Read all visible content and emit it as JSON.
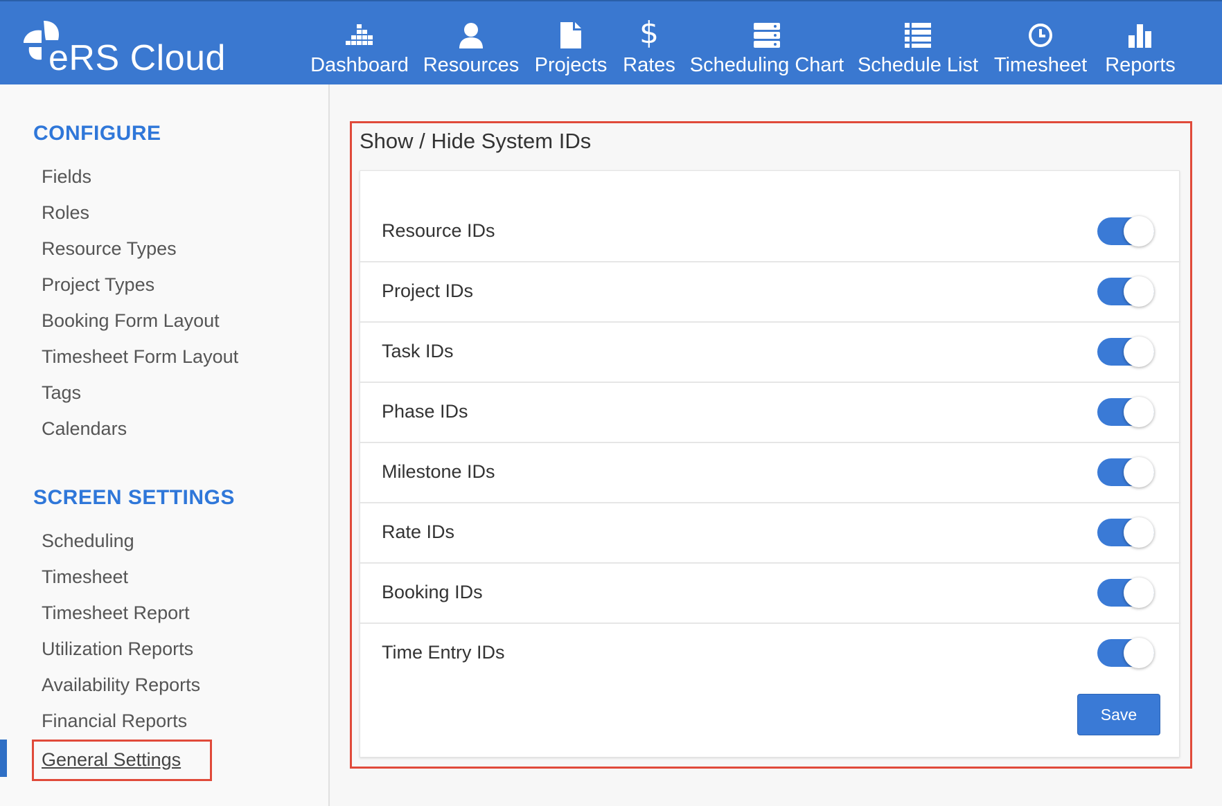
{
  "app": {
    "name": "eRS Cloud"
  },
  "nav": [
    {
      "label": "Dashboard",
      "icon": "dashboard-grid-icon"
    },
    {
      "label": "Resources",
      "icon": "user-icon"
    },
    {
      "label": "Projects",
      "icon": "document-icon"
    },
    {
      "label": "Rates",
      "icon": "dollar-icon"
    },
    {
      "label": "Scheduling Chart",
      "icon": "server-stack-icon"
    },
    {
      "label": "Schedule List",
      "icon": "list-icon"
    },
    {
      "label": "Timesheet",
      "icon": "clock-icon"
    },
    {
      "label": "Reports",
      "icon": "bar-chart-icon"
    }
  ],
  "sidebar": {
    "configure_title": "CONFIGURE",
    "configure_items": [
      "Fields",
      "Roles",
      "Resource Types",
      "Project Types",
      "Booking Form Layout",
      "Timesheet Form Layout",
      "Tags",
      "Calendars"
    ],
    "screen_title": "SCREEN SETTINGS",
    "screen_items": [
      "Scheduling",
      "Timesheet",
      "Timesheet Report",
      "Utilization Reports",
      "Availability Reports",
      "Financial Reports",
      "General Settings"
    ],
    "active_item": "General Settings"
  },
  "panel": {
    "title": "Show / Hide System IDs",
    "rows": [
      {
        "label": "Resource IDs",
        "enabled": true
      },
      {
        "label": "Project IDs",
        "enabled": true
      },
      {
        "label": "Task IDs",
        "enabled": true
      },
      {
        "label": "Phase IDs",
        "enabled": true
      },
      {
        "label": "Milestone IDs",
        "enabled": true
      },
      {
        "label": "Rate IDs",
        "enabled": true
      },
      {
        "label": "Booking IDs",
        "enabled": true
      },
      {
        "label": "Time Entry IDs",
        "enabled": true
      }
    ],
    "save_label": "Save"
  },
  "colors": {
    "brand": "#3a78d0",
    "accent": "#2f77d9",
    "highlight": "#e04a3a"
  }
}
